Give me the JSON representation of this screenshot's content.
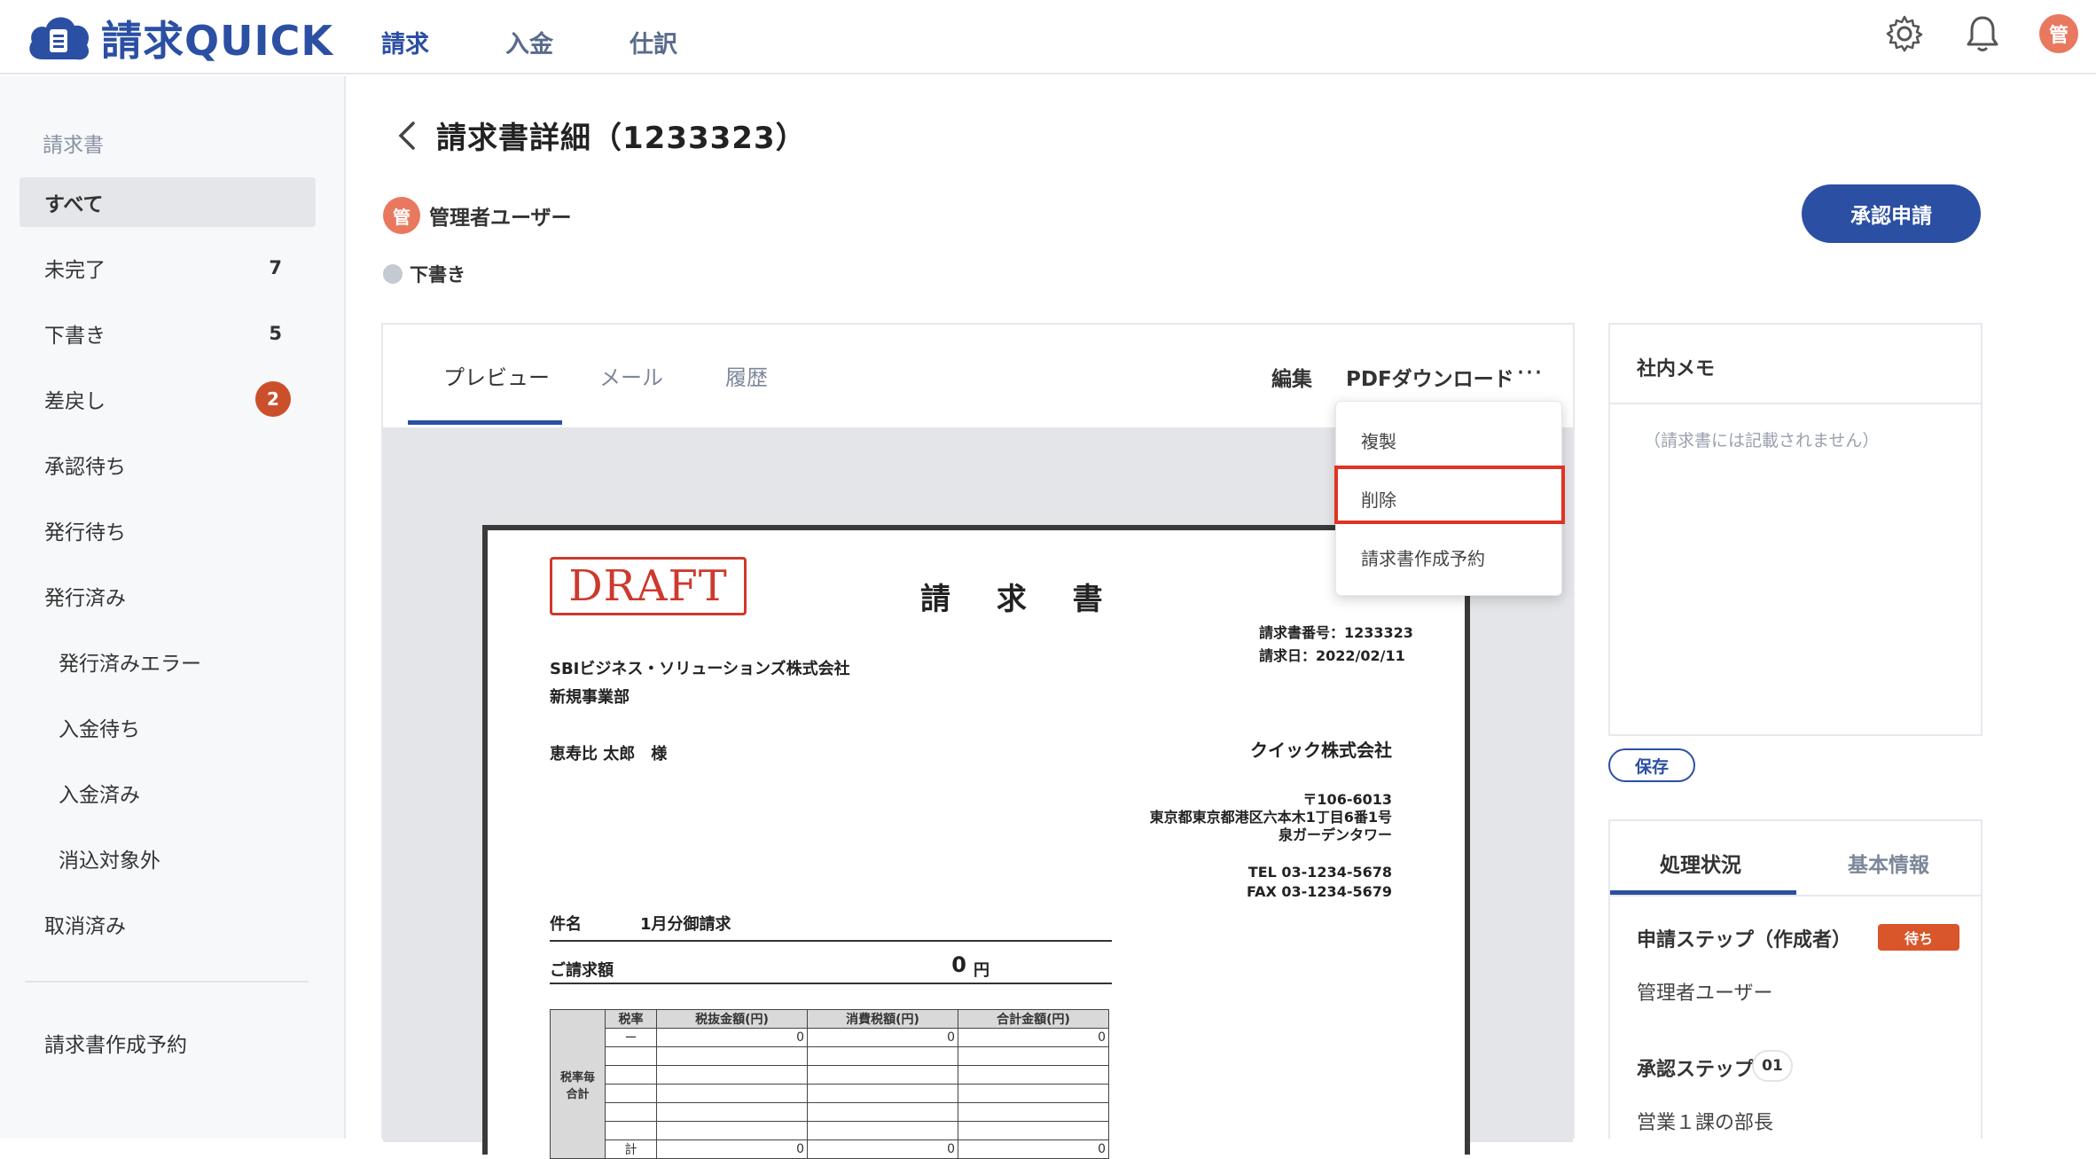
{
  "app": {
    "name": "請求QUICK",
    "brand_color": "#2b4fa3"
  },
  "nav": {
    "items": [
      "請求",
      "入金",
      "仕訳"
    ]
  },
  "user_initial": "管",
  "sidebar": {
    "section": "請求書",
    "items": [
      {
        "label": "すべて"
      },
      {
        "label": "未完了",
        "count": "7"
      },
      {
        "label": "下書き",
        "count": "5"
      },
      {
        "label": "差戻し",
        "badge": "2"
      },
      {
        "label": "承認待ち"
      },
      {
        "label": "発行待ち"
      },
      {
        "label": "発行済み"
      },
      {
        "label": "発行済みエラー"
      },
      {
        "label": "入金待ち"
      },
      {
        "label": "入金済み"
      },
      {
        "label": "消込対象外"
      },
      {
        "label": "取消済み"
      }
    ],
    "footer_item": "請求書作成予約"
  },
  "page": {
    "title": "請求書詳細（1233323）",
    "owner": "管理者ユーザー",
    "status": "下書き",
    "approve_button": "承認申請"
  },
  "tabs": {
    "preview": "プレビュー",
    "mail": "メール",
    "history": "履歴"
  },
  "actions": {
    "edit": "編集",
    "pdf": "PDFダウンロード",
    "more": "⋯"
  },
  "dropdown": {
    "items": [
      "複製",
      "削除",
      "請求書作成予約"
    ]
  },
  "invoice": {
    "stamp": "DRAFT",
    "title": "請 求 書",
    "number": "請求書番号：1233323",
    "date": "請求日：2022/02/11",
    "client_company": "SBIビジネス・ソリューションズ株式会社",
    "client_dept": "新規事業部",
    "client_person": "恵寿比 太郎　様",
    "issuer": "クイック株式会社",
    "postal": "〒106-6013",
    "address1": "東京都東京都港区六本木1丁目6番1号",
    "address2": "泉ガーデンタワー",
    "tel": "TEL 03-1234-5678",
    "fax": "FAX 03-1234-5679",
    "subject_label": "件名",
    "subject": "1月分御請求",
    "amount_label": "ご請求額",
    "amount": "0",
    "currency": "円",
    "table": {
      "headers": [
        "税率",
        "税抜金額(円)",
        "消費税額(円)",
        "合計金額(円)"
      ],
      "side_label": "税率毎\n合計",
      "first_row": [
        "ー",
        "0",
        "0",
        "0"
      ],
      "total_row": [
        "計",
        "0",
        "0",
        "0"
      ]
    }
  },
  "memo": {
    "title": "社内メモ",
    "placeholder": "（請求書には記載されません）",
    "save": "保存"
  },
  "process": {
    "tabs": [
      "処理状況",
      "基本情報"
    ],
    "step1": "申請ステップ（作成者）",
    "step1_badge": "待ち",
    "step1_user": "管理者ユーザー",
    "step2": "承認ステップ",
    "step2_num": "01",
    "step2_user": "営業１課の部長"
  }
}
